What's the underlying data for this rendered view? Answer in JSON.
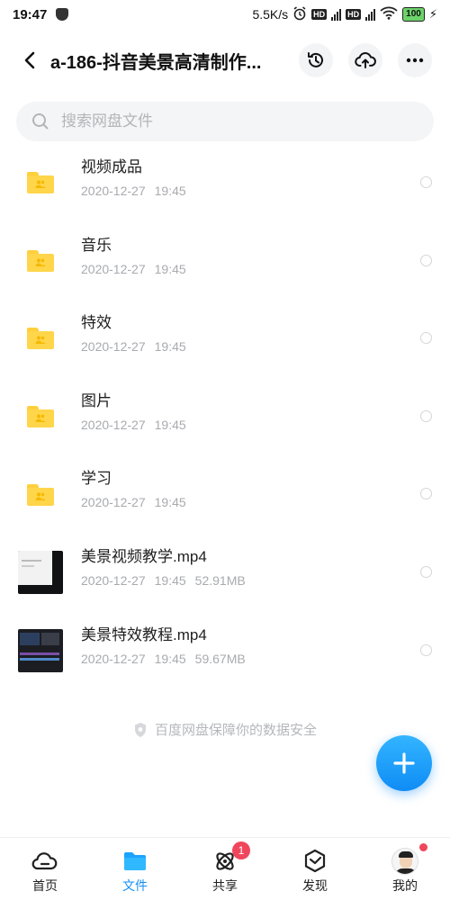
{
  "status_bar": {
    "time": "19:47",
    "net_speed": "5.5K/s",
    "hd1": "HD",
    "hd2": "HD",
    "battery": "100"
  },
  "header": {
    "title": "a-186-抖音美景高清制作...",
    "icons": [
      "back-icon",
      "history-icon",
      "cloud-upload-icon",
      "more-icon"
    ]
  },
  "search": {
    "placeholder": "搜索网盘文件"
  },
  "files": [
    {
      "name": "视频成品",
      "date": "2020-12-27",
      "time": "19:45",
      "size": "",
      "kind": "folder"
    },
    {
      "name": "音乐",
      "date": "2020-12-27",
      "time": "19:45",
      "size": "",
      "kind": "folder"
    },
    {
      "name": "特效",
      "date": "2020-12-27",
      "time": "19:45",
      "size": "",
      "kind": "folder"
    },
    {
      "name": "图片",
      "date": "2020-12-27",
      "time": "19:45",
      "size": "",
      "kind": "folder"
    },
    {
      "name": "学习",
      "date": "2020-12-27",
      "time": "19:45",
      "size": "",
      "kind": "folder"
    },
    {
      "name": "美景视频教学.mp4",
      "date": "2020-12-27",
      "time": "19:45",
      "size": "52.91MB",
      "kind": "video"
    },
    {
      "name": "美景特效教程.mp4",
      "date": "2020-12-27",
      "time": "19:45",
      "size": "59.67MB",
      "kind": "video"
    }
  ],
  "security_note": "百度网盘保障你的数据安全",
  "nav": {
    "items": [
      {
        "label": "首页",
        "icon": "home-cloud-icon"
      },
      {
        "label": "文件",
        "icon": "folder-icon"
      },
      {
        "label": "共享",
        "icon": "share-atom-icon",
        "badge": "1"
      },
      {
        "label": "发现",
        "icon": "discover-cube-icon"
      },
      {
        "label": "我的",
        "icon": "avatar"
      }
    ],
    "active_color": "#1591f5"
  },
  "colors": {
    "accent": "#1591f5",
    "folder": "#ffd54a",
    "badge": "#f0465c"
  }
}
